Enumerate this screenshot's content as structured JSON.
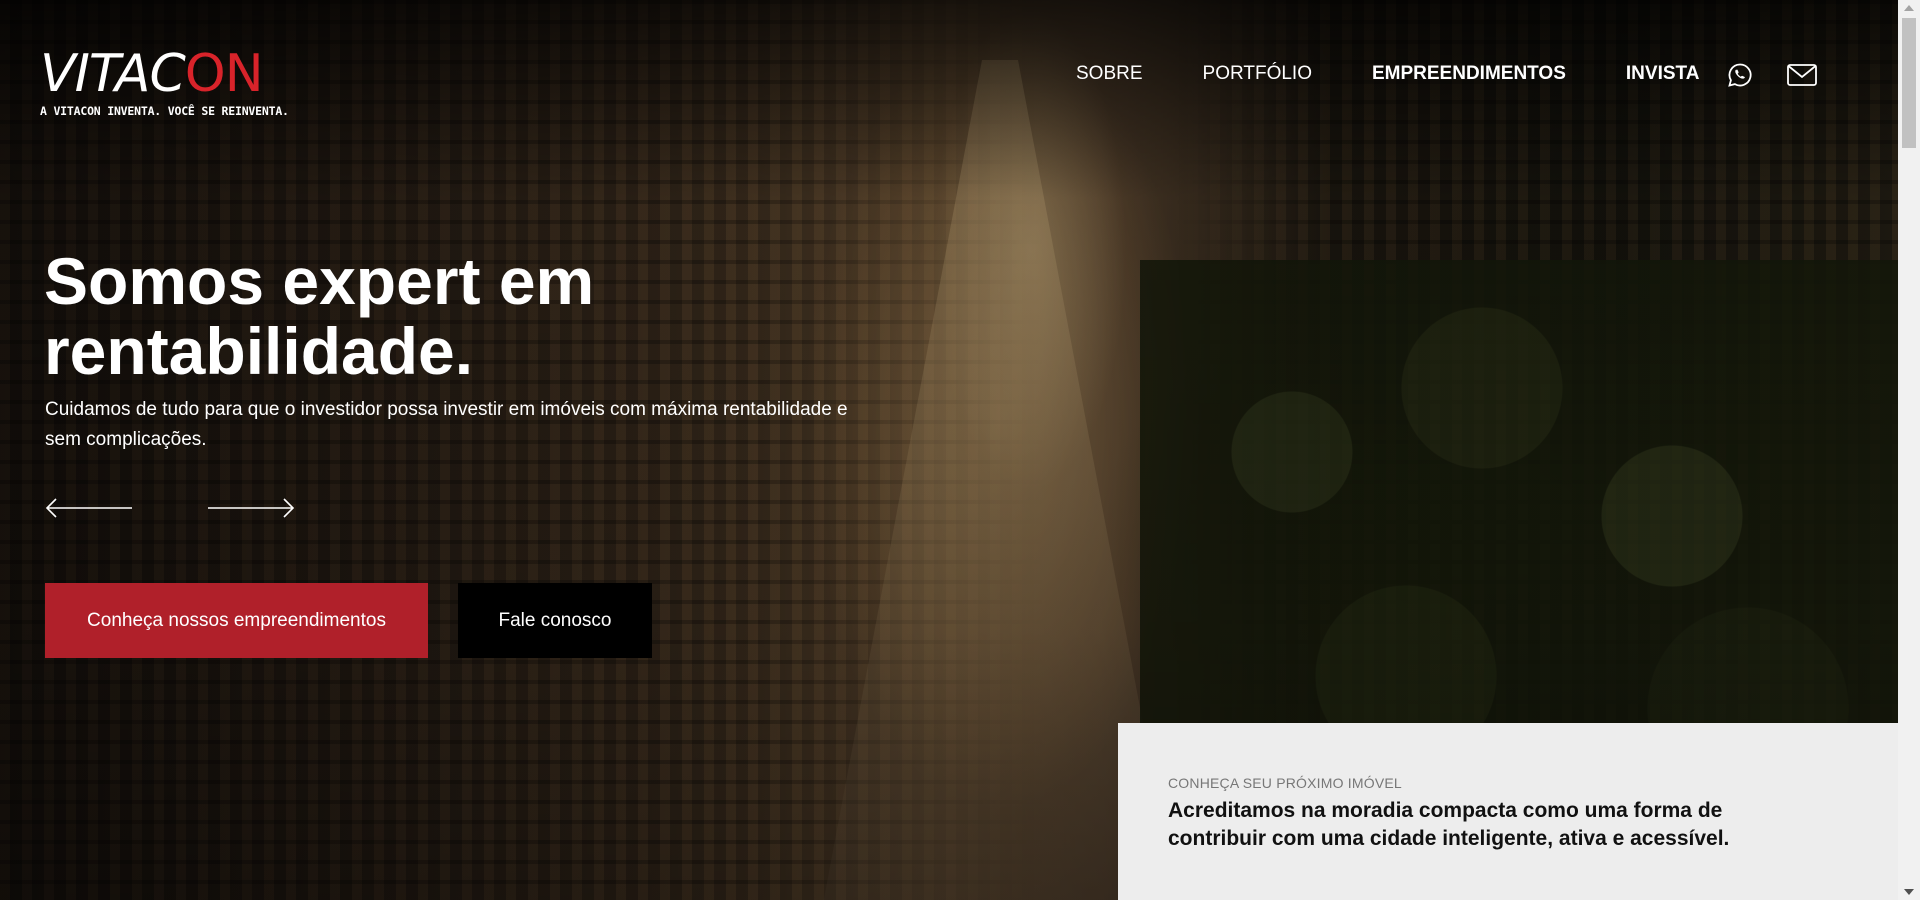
{
  "brand": {
    "logo_main": "VITAC",
    "logo_accent": "ON",
    "tagline": "A VITACON INVENTA. VOCÊ SE REINVENTA.",
    "accent_color": "#d8232a"
  },
  "nav": {
    "items": [
      {
        "label": "SOBRE",
        "bold": false
      },
      {
        "label": "PORTFÓLIO",
        "bold": false
      },
      {
        "label": "EMPREENDIMENTOS",
        "bold": true
      },
      {
        "label": "INVISTA",
        "bold": true
      }
    ],
    "icons": [
      "whatsapp-icon",
      "mail-icon"
    ]
  },
  "hero": {
    "headline": "Somos expert em rentabilidade.",
    "subtext": "Cuidamos de tudo para que o investidor possa investir em imóveis com máxima rentabilidade e sem complicações.",
    "primary_cta": "Conheça nossos empreendimentos",
    "secondary_cta": "Fale conosco",
    "primary_color": "#b0202a"
  },
  "info_card": {
    "eyebrow": "CONHEÇA SEU PRÓXIMO IMÓVEL",
    "text": "Acreditamos na moradia compacta como uma forma de contribuir com uma cidade inteligente, ativa e acessível."
  }
}
